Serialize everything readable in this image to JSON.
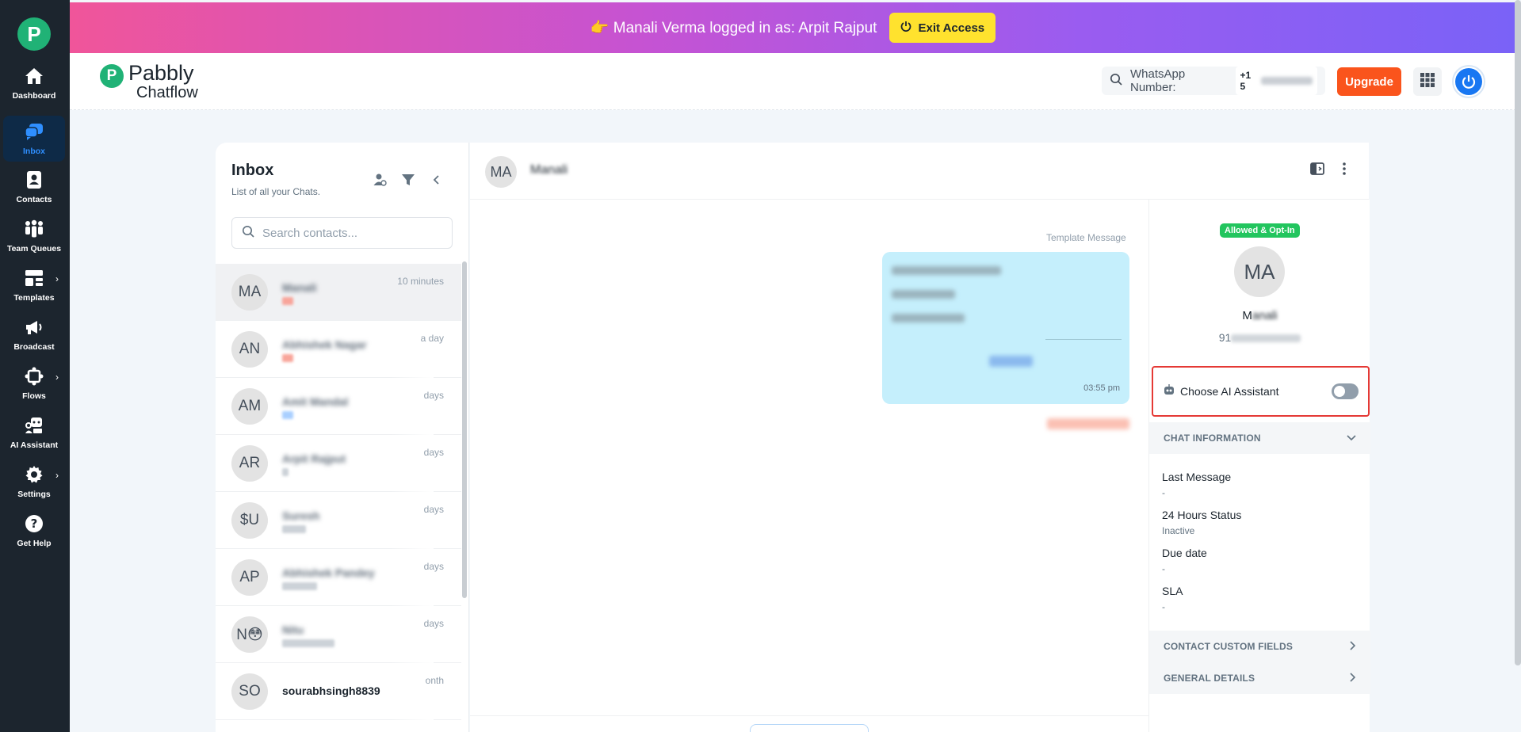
{
  "sidebar": {
    "items": [
      {
        "label": "Dashboard",
        "icon": "home-icon"
      },
      {
        "label": "Inbox",
        "icon": "chat-bubbles-icon"
      },
      {
        "label": "Contacts",
        "icon": "contact-book-icon"
      },
      {
        "label": "Team Queues",
        "icon": "team-icon"
      },
      {
        "label": "Templates",
        "icon": "templates-icon"
      },
      {
        "label": "Broadcast",
        "icon": "megaphone-icon"
      },
      {
        "label": "Flows",
        "icon": "flow-icon"
      },
      {
        "label": "AI Assistant",
        "icon": "ai-assistant-icon"
      },
      {
        "label": "Settings",
        "icon": "gear-icon"
      },
      {
        "label": "Get Help",
        "icon": "help-icon"
      }
    ]
  },
  "banner": {
    "text": "👉 Manali Verma logged in as: Arpit Rajput",
    "exit_label": "Exit Access"
  },
  "header": {
    "logo_line1": "Pabbly",
    "logo_line2": "Chatflow",
    "whatsapp_label": "WhatsApp Number:",
    "whatsapp_prefix": "+1 5",
    "upgrade_label": "Upgrade"
  },
  "inbox": {
    "title": "Inbox",
    "subtitle": "List of all your Chats.",
    "search_placeholder": "Search contacts...",
    "chats": [
      {
        "initials": "MA",
        "name": "Manali",
        "time": "10 minutes"
      },
      {
        "initials": "AN",
        "name": "Abhishek Nagar",
        "time": "a day"
      },
      {
        "initials": "AM",
        "name": "Amit Mandal",
        "time": "days"
      },
      {
        "initials": "AR",
        "name": "Arpit Rajput",
        "time": "days"
      },
      {
        "initials": "$U",
        "name": "Suresh",
        "time": "days"
      },
      {
        "initials": "AP",
        "name": "Abhishek Pandey",
        "time": "days"
      },
      {
        "initials": "N😳",
        "name": "Nitu",
        "time": "days"
      },
      {
        "initials": "SO",
        "name": "sourabhsingh8839",
        "time": "onth"
      }
    ]
  },
  "chat": {
    "initials": "MA",
    "name": "Manali",
    "template_label": "Template Message",
    "message_time": "03:55 pm"
  },
  "contact": {
    "optin_badge": "Allowed & Opt-In",
    "initials": "MA",
    "name_prefix": "M",
    "name_rest": "anali",
    "phone_prefix": "91",
    "ai_label": "Choose AI Assistant",
    "chat_info_title": "CHAT INFORMATION",
    "fields": [
      {
        "key": "Last Message",
        "value": "-"
      },
      {
        "key": "24 Hours Status",
        "value": "Inactive"
      },
      {
        "key": "Due date",
        "value": "-"
      },
      {
        "key": "SLA",
        "value": "-"
      }
    ],
    "custom_fields_title": "CONTACT CUSTOM FIELDS",
    "general_details_title": "GENERAL DETAILS"
  },
  "colors": {
    "sidebar_bg": "#1c252e",
    "brand_green": "#20b276",
    "accent_blue": "#2f8fff",
    "upgrade_orange": "#fa541c",
    "exit_yellow": "#ffe22e",
    "highlight_red": "#e53935"
  }
}
